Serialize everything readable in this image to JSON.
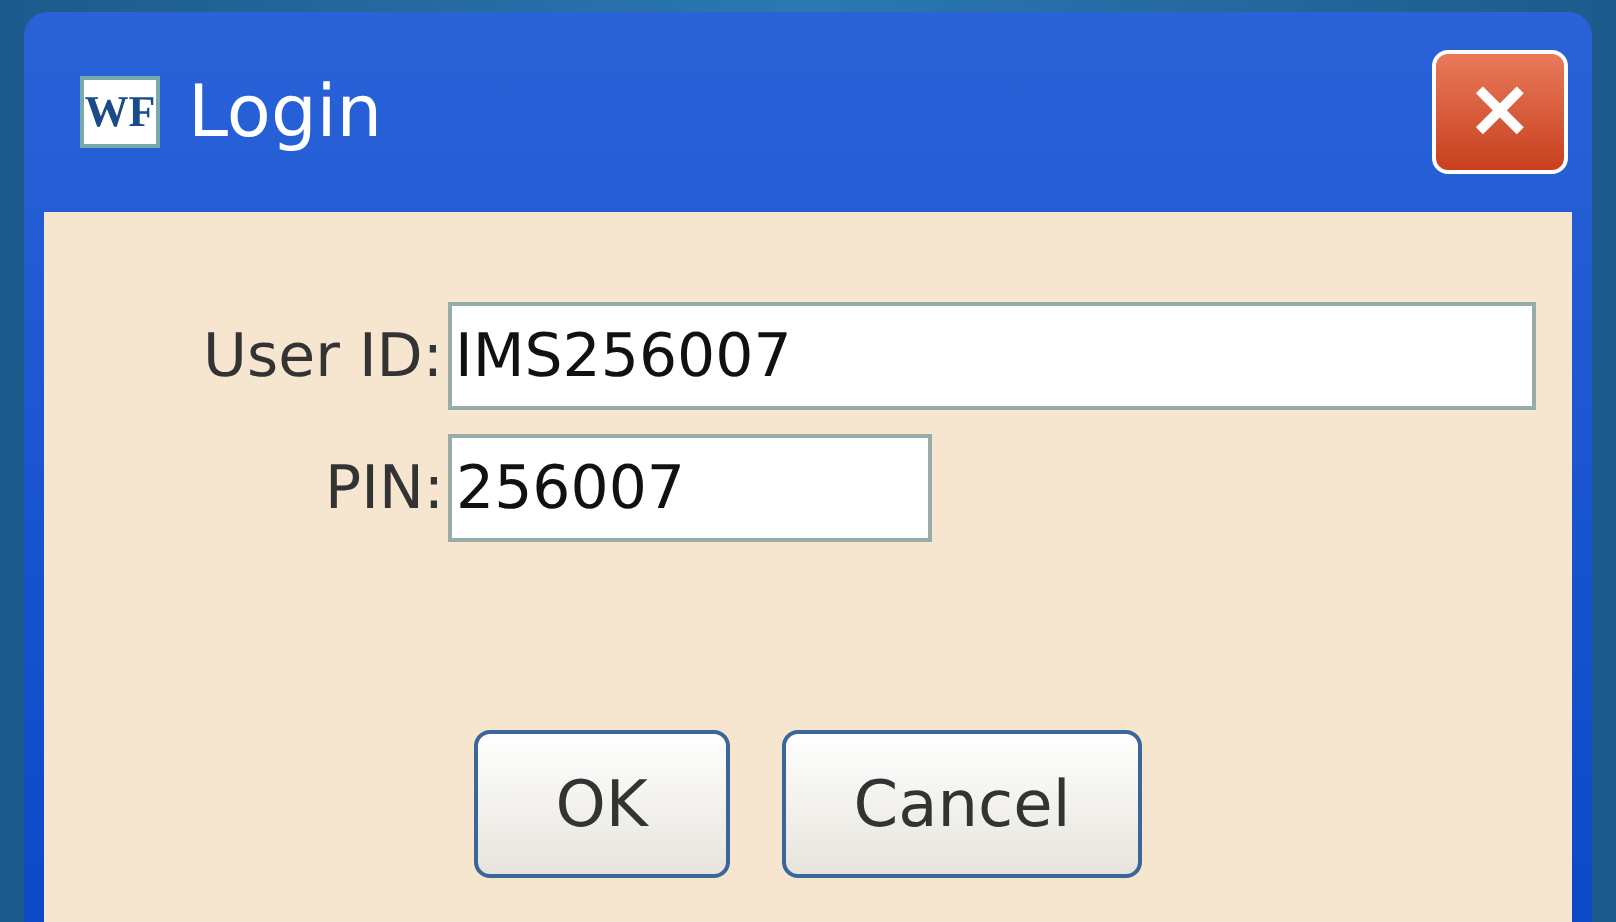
{
  "window": {
    "title": "Login",
    "app_icon_text": "WF",
    "close_glyph": "✕"
  },
  "fields": [
    {
      "label": "User ID:",
      "value": "IMS256007",
      "kind": "wide"
    },
    {
      "label": "PIN:",
      "value": "256007",
      "kind": "narrow"
    }
  ],
  "buttons": [
    "OK",
    "Cancel"
  ]
}
